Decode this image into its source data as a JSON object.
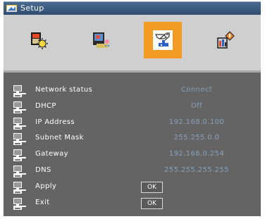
{
  "window": {
    "title": "Setup"
  },
  "tabs": [
    {
      "name": "image-settings",
      "active": false
    },
    {
      "name": "display-settings",
      "active": false
    },
    {
      "name": "setup",
      "active": true
    },
    {
      "name": "options",
      "active": false
    }
  ],
  "colors": {
    "active_tab": "#f39a22",
    "label_text": "#ffffff",
    "value_text": "#87a0b9",
    "panel_bg": "#646464",
    "header_bg": "#2e4d71"
  },
  "settings": {
    "network_status": {
      "label": "Network status",
      "value": "Connect"
    },
    "dhcp": {
      "label": "DHCP",
      "value": "Off"
    },
    "ip_address": {
      "label": "IP Address",
      "value": "192.168.0.100"
    },
    "subnet_mask": {
      "label": "Subnet Mask",
      "value": "255.255.0.0"
    },
    "gateway": {
      "label": "Gateway",
      "value": "192.168.0.254"
    },
    "dns": {
      "label": "DNS",
      "value": "255.255.255.255"
    },
    "apply": {
      "label": "Apply",
      "button": "OK"
    },
    "exit": {
      "label": "Exit",
      "button": "OK"
    }
  }
}
